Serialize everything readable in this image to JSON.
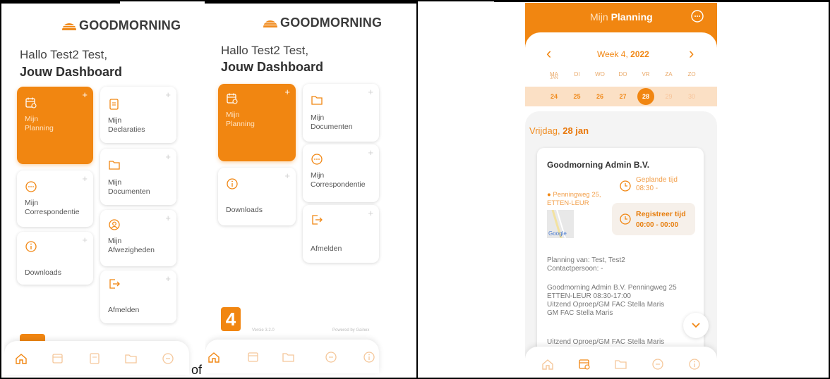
{
  "brand": {
    "name": "GOODMORNING",
    "accent": "#f18611"
  },
  "panel1": {
    "greeting": "Hallo Test2 Test,",
    "dashboard": "Jouw Dashboard",
    "tiles": [
      {
        "label": "Mijn\nPlanning",
        "icon": "calendar-icon",
        "highlighted": true
      },
      {
        "label": "Mijn\nDeclaraties",
        "icon": "document-icon"
      },
      {
        "label": "Mijn\nDocumenten",
        "icon": "folder-icon"
      },
      {
        "label": "Mijn\nCorrespondentie",
        "icon": "chat-icon"
      },
      {
        "label": "Mijn\nAfwezigheden",
        "icon": "user-circle-icon"
      },
      {
        "label": "Downloads",
        "icon": "info-icon"
      },
      {
        "label": "Afmelden",
        "icon": "logout-icon"
      }
    ],
    "plus": "+",
    "nav": [
      "home-icon",
      "calendar-icon",
      "document-icon",
      "folder-icon",
      "chat-icon"
    ]
  },
  "separator_text": "of",
  "panel2": {
    "greeting": "Hallo Test2 Test,",
    "dashboard": "Jouw Dashboard",
    "tiles": [
      {
        "label": "Mijn\nPlanning",
        "icon": "calendar-icon",
        "highlighted": true
      },
      {
        "label": "Mijn\nDocumenten",
        "icon": "folder-icon"
      },
      {
        "label": "Mijn\nCorrespondentie",
        "icon": "chat-icon"
      },
      {
        "label": "Downloads",
        "icon": "info-icon"
      },
      {
        "label": "Afmelden",
        "icon": "logout-icon"
      }
    ],
    "plus": "+",
    "badge": "4",
    "version": "Versie 3.2.0",
    "powered": "Powered by Gainex",
    "nav": [
      "home-icon",
      "calendar-icon",
      "folder-icon",
      "chat-icon",
      "info-icon"
    ]
  },
  "planning": {
    "title_prefix": "Mijn ",
    "title_bold": "Planning",
    "week_label": "Week 4, ",
    "week_year": "2022",
    "prev": "‹",
    "next": "›",
    "day_names": [
      "MA",
      "DI",
      "WO",
      "DO",
      "VR",
      "ZA",
      "ZO"
    ],
    "day_sub": "JAN",
    "day_numbers": [
      "24",
      "25",
      "26",
      "27",
      "28",
      "29",
      "30"
    ],
    "selected_index": 4,
    "date_prefix": "Vrijdag, ",
    "date_bold": "28 jan",
    "company": "Goodmorning Admin B.V.",
    "address_line1": "Penningweg 25,",
    "address_line2": "ETTEN-LEUR",
    "planned_label": "Geplande tijd",
    "planned_time": "08:30 -",
    "register_label": "Registreer tijd",
    "register_time": "00:00 - 00:00",
    "map_label": "Google",
    "planning_of": "Planning van: Test, Test2",
    "contact": "Contactpersoon: -",
    "detail_lines": [
      "Goodmorning Admin B.V. Penningweg 25",
      "ETTEN-LEUR 08:30-17:00",
      "Uitzend Oproep/GM FAC Stella Maris",
      "GM FAC Stella Maris"
    ],
    "bottom_line": "Uitzend Oproep/GM FAC Stella Maris",
    "nav": [
      "home-icon",
      "calendar-icon",
      "folder-icon",
      "chat-icon",
      "info-icon"
    ]
  }
}
